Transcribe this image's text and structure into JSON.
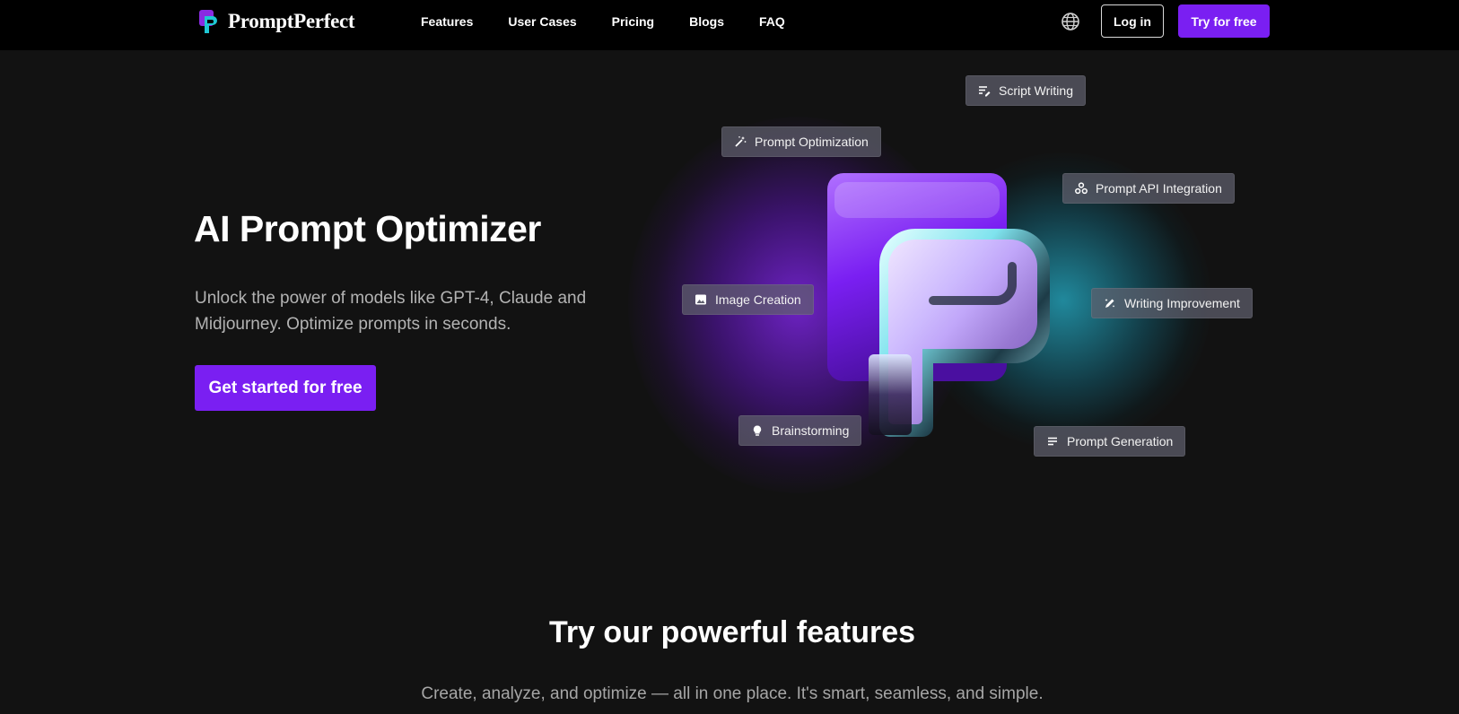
{
  "header": {
    "brand": "PromptPerfect",
    "nav": [
      "Features",
      "User Cases",
      "Pricing",
      "Blogs",
      "FAQ"
    ],
    "login_label": "Log in",
    "try_label": "Try for free",
    "language_icon": "globe-icon"
  },
  "hero": {
    "title": "AI Prompt Optimizer",
    "subtitle": "Unlock the power of models like GPT-4, Claude and Midjourney. Optimize prompts in seconds.",
    "cta_label": "Get started for free"
  },
  "feature_chips": {
    "script_writing": {
      "label": "Script Writing",
      "icon": "script-icon"
    },
    "prompt_optimization": {
      "label": "Prompt Optimization",
      "icon": "magic-wand-icon"
    },
    "api_integration": {
      "label": "Prompt API Integration",
      "icon": "integration-icon"
    },
    "image_creation": {
      "label": "Image Creation",
      "icon": "image-icon"
    },
    "writing_improvement": {
      "label": "Writing Improvement",
      "icon": "edit-sparkle-icon"
    },
    "brainstorming": {
      "label": "Brainstorming",
      "icon": "lightbulb-icon"
    },
    "prompt_generation": {
      "label": "Prompt Generation",
      "icon": "text-lines-icon"
    }
  },
  "features": {
    "title": "Try our powerful features",
    "subtitle": "Create, analyze, and optimize — all in one place. It's smart, seamless, and simple."
  },
  "colors": {
    "accent": "#7a1ff2",
    "background": "#121212",
    "header_bg": "#000000"
  }
}
